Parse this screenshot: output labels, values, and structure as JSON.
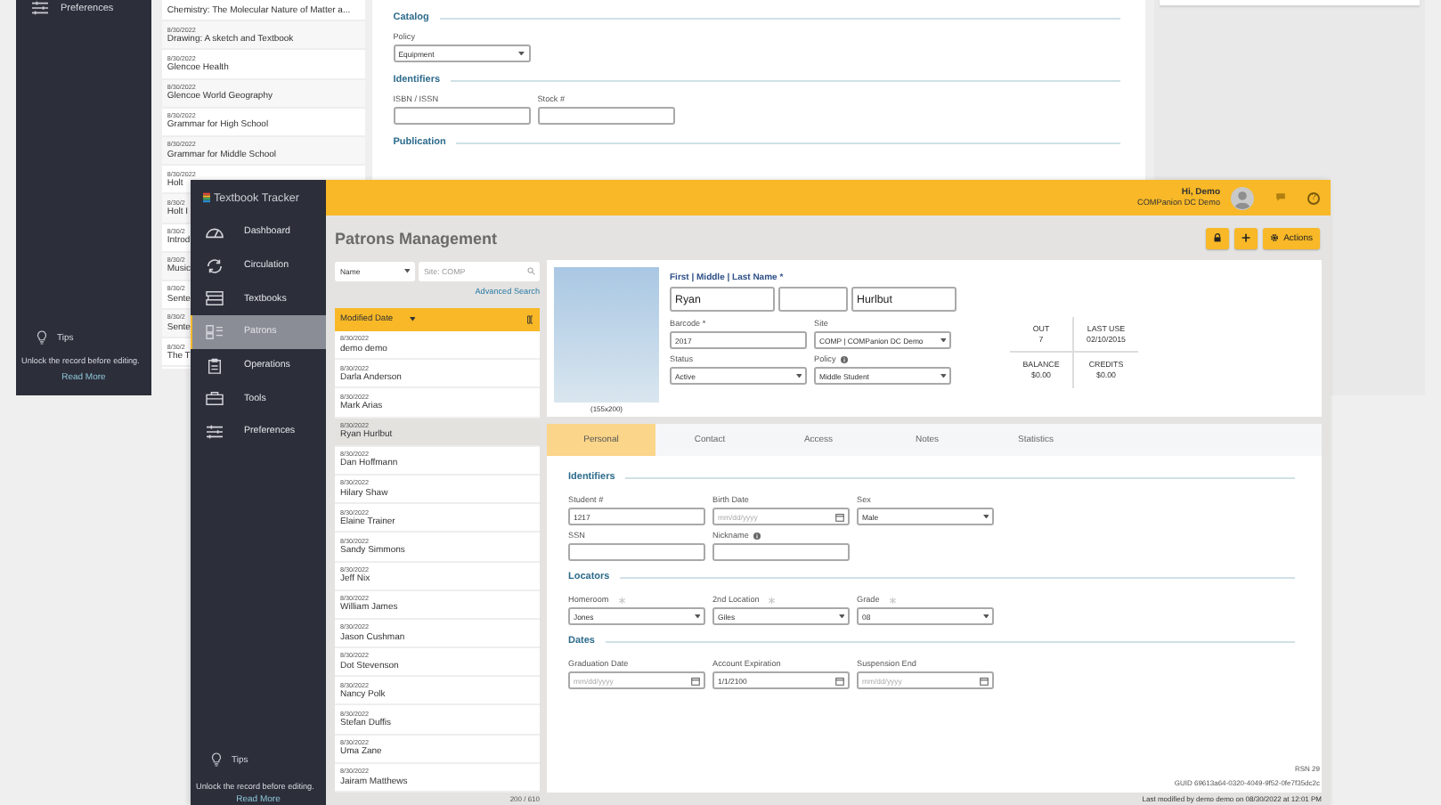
{
  "back_window": {
    "sidebar": {
      "items": [
        {
          "label": "Preferences"
        }
      ],
      "tips": {
        "title": "Tips",
        "text": "Unlock the record before editing.",
        "link": "Read More"
      }
    },
    "list": [
      {
        "title": "Chemistry: The Molecular Nature of Matter a..."
      },
      {
        "date": "8/30/2022",
        "title": "Drawing: A sketch and Textbook"
      },
      {
        "date": "8/30/2022",
        "title": "Glencoe Health"
      },
      {
        "date": "8/30/2022",
        "title": "Glencoe World Geography"
      },
      {
        "date": "8/30/2022",
        "title": "Grammar for High School"
      },
      {
        "date": "8/30/2022",
        "title": "Grammar for Middle School"
      },
      {
        "date": "8/30/2022",
        "title": "Holt"
      },
      {
        "date": "8/30/2",
        "title": "Holt I"
      },
      {
        "date": "8/30/2",
        "title": "Introd"
      },
      {
        "date": "8/30/2",
        "title": "Music"
      },
      {
        "date": "8/30/2",
        "title": "Sente"
      },
      {
        "date": "8/30/2",
        "title": "Sente"
      },
      {
        "date": "8/30/2",
        "title": "The T"
      }
    ],
    "sections": [
      {
        "title": "Catalog",
        "fields": [
          {
            "label": "Policy",
            "kind": "select",
            "value": "Equipment"
          }
        ]
      },
      {
        "title": "Identifiers",
        "fields": [
          {
            "label": "ISBN / ISSN",
            "kind": "text"
          },
          {
            "label": "Stock #",
            "kind": "text"
          }
        ]
      },
      {
        "title": "Publication"
      }
    ]
  },
  "window": {
    "app_name": "Textbook Tracker",
    "user": {
      "greeting": "Hi, Demo",
      "site": "COMPanion DC Demo",
      "help": "?"
    },
    "sidebar": {
      "items": [
        {
          "label": "Dashboard",
          "selected": false
        },
        {
          "label": "Circulation",
          "selected": false
        },
        {
          "label": "Textbooks",
          "selected": false
        },
        {
          "label": "Patrons",
          "selected": true
        },
        {
          "label": "Operations",
          "selected": false
        },
        {
          "label": "Tools",
          "selected": false
        },
        {
          "label": "Preferences",
          "selected": false
        }
      ],
      "tips": {
        "title": "Tips",
        "text": "Unlock the record before editing.",
        "link": "Read More"
      }
    },
    "title": "Patrons Management",
    "actions": {
      "label": "Actions"
    },
    "search": {
      "field": "Name",
      "placeholder": "Site: COMP",
      "advanced": "Advanced Search"
    },
    "list": {
      "sort": "Modified Date",
      "count": "200 / 610",
      "rows": [
        {
          "date": "8/30/2022",
          "name": "demo demo",
          "selected": false
        },
        {
          "date": "8/30/2022",
          "name": "Darla Anderson",
          "selected": false
        },
        {
          "date": "8/30/2022",
          "name": "Mark Arias",
          "selected": false
        },
        {
          "date": "8/30/2022",
          "name": "Ryan Hurlbut",
          "selected": true
        },
        {
          "date": "8/30/2022",
          "name": "Dan Hoffmann",
          "selected": false
        },
        {
          "date": "8/30/2022",
          "name": "Hilary Shaw",
          "selected": false
        },
        {
          "date": "8/30/2022",
          "name": "Elaine Trainer",
          "selected": false
        },
        {
          "date": "8/30/2022",
          "name": "Sandy Simmons",
          "selected": false
        },
        {
          "date": "8/30/2022",
          "name": "Jeff Nix",
          "selected": false
        },
        {
          "date": "8/30/2022",
          "name": "William James",
          "selected": false
        },
        {
          "date": "8/30/2022",
          "name": "Jason Cushman",
          "selected": false
        },
        {
          "date": "8/30/2022",
          "name": "Dot Stevenson",
          "selected": false
        },
        {
          "date": "8/30/2022",
          "name": "Nancy Polk",
          "selected": false
        },
        {
          "date": "8/30/2022",
          "name": "Stefan Duffis",
          "selected": false
        },
        {
          "date": "8/30/2022",
          "name": "Uma Zane",
          "selected": false
        },
        {
          "date": "8/30/2022",
          "name": "Jairam Matthews",
          "selected": false
        }
      ]
    },
    "record": {
      "photo_caption": "(155x200)",
      "name_label": "First | Middle | Last Name *",
      "name": {
        "first": "Ryan",
        "last": "Hurlbut"
      },
      "fields": [
        {
          "label": "Barcode *",
          "kind": "text",
          "value": "2017"
        },
        {
          "label": "Site",
          "kind": "select",
          "value": "COMP | COMPanion DC Demo"
        },
        {
          "label": "Status",
          "kind": "select",
          "value": "Active"
        },
        {
          "label": "Policy",
          "kind": "select",
          "value": "Middle Student",
          "info": true
        }
      ],
      "stats": [
        {
          "label": "OUT",
          "value": "7"
        },
        {
          "label": "LAST USE",
          "value": "02/10/2015"
        },
        {
          "label": "BALANCE",
          "value": "$0.00"
        },
        {
          "label": "CREDITS",
          "value": "$0.00"
        }
      ]
    },
    "tabs": [
      {
        "label": "Personal",
        "selected": true
      },
      {
        "label": "Contact",
        "selected": false
      },
      {
        "label": "Access",
        "selected": false
      },
      {
        "label": "Notes",
        "selected": false
      },
      {
        "label": "Statistics",
        "selected": false
      }
    ],
    "sections": [
      {
        "title": "Identifiers",
        "fields": [
          {
            "label": "Student #",
            "kind": "text",
            "value": "1217"
          },
          {
            "label": "Birth Date",
            "kind": "date",
            "placeholder": "mm/dd/yyyy"
          },
          {
            "label": "Sex",
            "kind": "select",
            "value": "Male"
          },
          {
            "label": "SSN",
            "kind": "text"
          },
          {
            "label": "Nickname",
            "kind": "text",
            "info": true
          }
        ]
      },
      {
        "title": "Locators",
        "fields": [
          {
            "label": "Homeroom",
            "kind": "select",
            "value": "Jones",
            "hint": true
          },
          {
            "label": "2nd Location",
            "kind": "select",
            "value": "Giles",
            "hint": true
          },
          {
            "label": "Grade",
            "kind": "select",
            "value": "08",
            "hint": true
          }
        ]
      },
      {
        "title": "Dates",
        "fields": [
          {
            "label": "Graduation Date",
            "kind": "date",
            "placeholder": "mm/dd/yyyy"
          },
          {
            "label": "Account Expiration",
            "kind": "date",
            "value": "1/1/2100"
          },
          {
            "label": "Suspension End",
            "kind": "date",
            "placeholder": "mm/dd/yyyy"
          }
        ]
      }
    ],
    "rsn": "RSN 29",
    "guid": "GUID 69613a64-0320-4049-9f52-0fe7f35dc2c",
    "modified": "Last modified by demo demo on 08/30/2022 at 12:01 PM"
  }
}
